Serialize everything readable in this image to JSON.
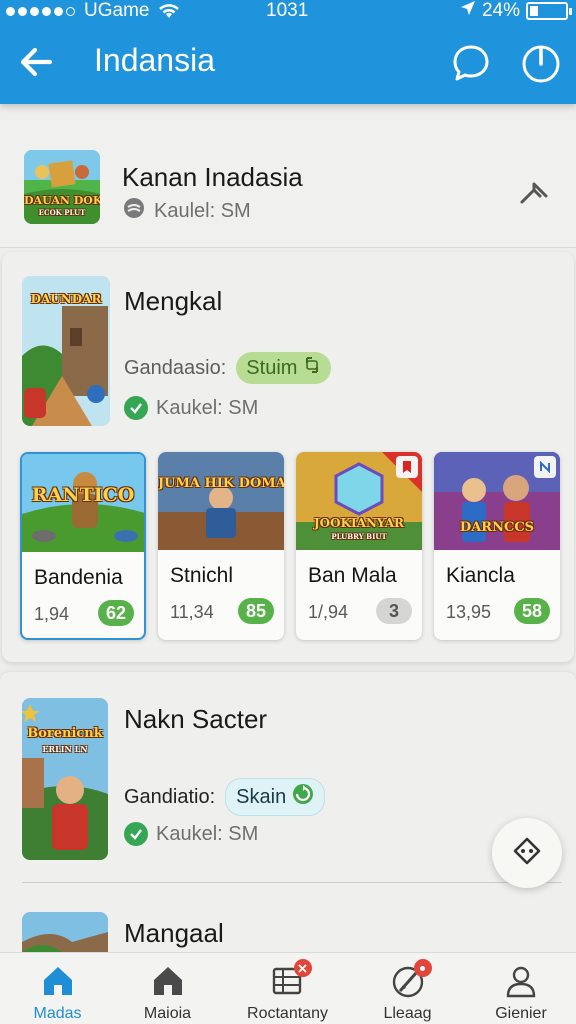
{
  "status_bar": {
    "carrier": "UGame",
    "time": "1031",
    "battery": "24%",
    "battery_level": 0.24
  },
  "app_bar": {
    "title": "Indansia"
  },
  "featured": {
    "title": "Kanan Inadasia",
    "meta": "Kaulel: SM",
    "thumb_text": "DAUAN DOKA",
    "thumb_sub": "ECOK PLUT"
  },
  "section_mengkal": {
    "title": "Mengkal",
    "genre_label": "Gandaasio:",
    "genre_value": "Stuim",
    "meta": "Kaukel: SM",
    "thumb_text": "DAUNDAR",
    "games": [
      {
        "name": "Bandenia",
        "price": "1,94",
        "score": "62",
        "cover_text": "RANTICO",
        "selected": true
      },
      {
        "name": "Stnichl",
        "price": "11,34",
        "score": "85",
        "cover_text": "JUMA HIK DOMAN",
        "selected": false
      },
      {
        "name": "Ban Mala",
        "price": "1/,94",
        "score": "3",
        "cover_text": "JOOKIANYAR",
        "cover_sub": "PLUBRY BIUT",
        "selected": false
      },
      {
        "name": "Kiancla",
        "price": "13,95",
        "score": "58",
        "cover_text": "DARNCCS",
        "selected": false
      }
    ]
  },
  "section_nakn": {
    "title": "Nakn Sacter",
    "genre_label": "Gandiatio:",
    "genre_value": "Skain",
    "meta": "Kaukel: SM",
    "thumb_text": "Borenicnk",
    "thumb_sub": "ERLIN LN"
  },
  "section_partial": {
    "title": "Mangaal"
  },
  "bottom_nav": [
    {
      "label": "Madas",
      "icon": "home-icon",
      "active": true
    },
    {
      "label": "Maioia",
      "icon": "home-icon",
      "active": false
    },
    {
      "label": "Roctantany",
      "icon": "grid-list-icon",
      "active": false
    },
    {
      "label": "Lleaag",
      "icon": "pen-icon",
      "active": false
    },
    {
      "label": "Gienier",
      "icon": "person-icon",
      "active": false
    }
  ],
  "colors": {
    "app_bar": "#1f94dc",
    "accent": "#1f8ed6",
    "score_green": "#57b24a",
    "check_green": "#35a654"
  }
}
